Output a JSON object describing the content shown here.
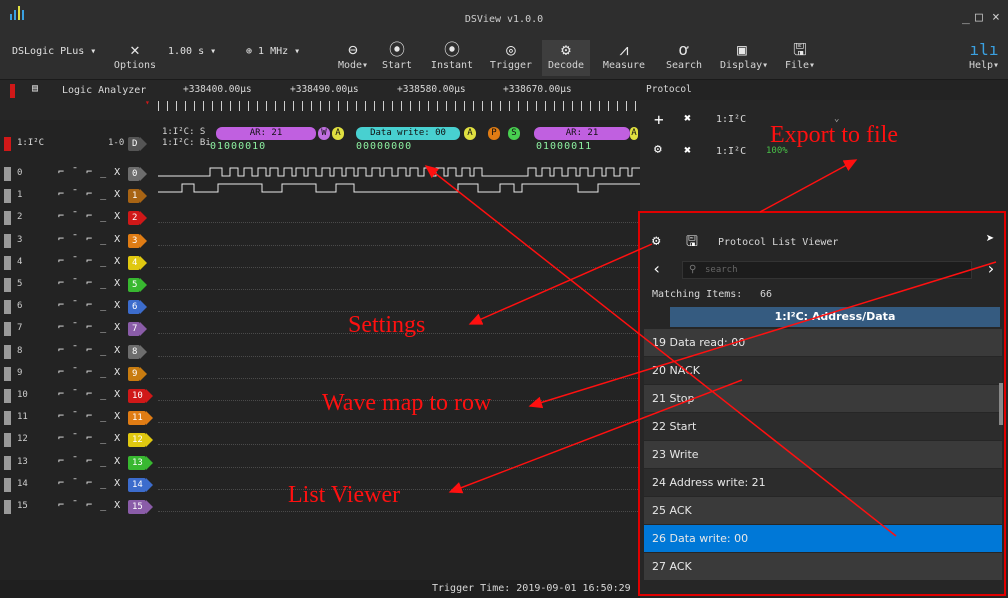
{
  "window": {
    "title": "DSView v1.0.0",
    "controls": [
      "_",
      "□",
      "×"
    ]
  },
  "toolbar": {
    "device": "DSLogic PLus",
    "options": "Options",
    "duration": "1.00 s",
    "rate": "1 MHz",
    "mode": "Mode",
    "start": "Start",
    "instant": "Instant",
    "trigger": "Trigger",
    "decode": "Decode",
    "measure": "Measure",
    "search": "Search",
    "display": "Display",
    "file": "File",
    "help": "Help"
  },
  "header": {
    "analyzer": "Logic Analyzer",
    "protocol": "Protocol",
    "time_labels": [
      "+338400.00μs",
      "+338490.00μs",
      "+338580.00μs",
      "+338670.00μs"
    ]
  },
  "decoder_row": {
    "name": "1:I²C",
    "range": "1-0",
    "tag": "D",
    "line1": "1:I²C: S",
    "line2": "1:I²C: Bi",
    "ar1": "AR: 21",
    "w": "W",
    "a1": "A",
    "dw": "Data write: 00",
    "a2": "A",
    "p": "P",
    "s": "S",
    "ar2": "AR: 21",
    "a3": "A",
    "bits1": "01000010",
    "bits2": "00000000",
    "bits3": "01000011"
  },
  "channels": [
    {
      "num": "0",
      "tag": "0",
      "color": "#6d6d6d"
    },
    {
      "num": "1",
      "tag": "1",
      "color": "#a86414"
    },
    {
      "num": "2",
      "tag": "2",
      "color": "#d01818"
    },
    {
      "num": "3",
      "tag": "3",
      "color": "#e07c14"
    },
    {
      "num": "4",
      "tag": "4",
      "color": "#e0c810"
    },
    {
      "num": "5",
      "tag": "5",
      "color": "#38b830"
    },
    {
      "num": "6",
      "tag": "6",
      "color": "#3c6ccc"
    },
    {
      "num": "7",
      "tag": "7",
      "color": "#8a5ca8"
    },
    {
      "num": "8",
      "tag": "8",
      "color": "#6d6d6d"
    },
    {
      "num": "9",
      "tag": "9",
      "color": "#c87c10"
    },
    {
      "num": "10",
      "tag": "10",
      "color": "#d01818"
    },
    {
      "num": "11",
      "tag": "11",
      "color": "#e07c14"
    },
    {
      "num": "12",
      "tag": "12",
      "color": "#e0c810"
    },
    {
      "num": "13",
      "tag": "13",
      "color": "#38b830"
    },
    {
      "num": "14",
      "tag": "14",
      "color": "#3c6ccc"
    },
    {
      "num": "15",
      "tag": "15",
      "color": "#8a5ca8"
    }
  ],
  "trigger_glyph": "⌐ ¯ ⌐ _ X",
  "status": {
    "trigger_time": "Trigger Time: 2019-09-01 16:50:29"
  },
  "protocol_panel": {
    "decoder1": "1:I²C",
    "decoder2": "1:I²C",
    "pct": "100%"
  },
  "list_viewer": {
    "title": "Protocol List Viewer",
    "search_placeholder": "search",
    "matching_label": "Matching Items:",
    "matching_count": "66",
    "column": "1:I²C: Address/Data",
    "rows": [
      {
        "idx": "19",
        "text": "Data read: 00"
      },
      {
        "idx": "20",
        "text": "NACK"
      },
      {
        "idx": "21",
        "text": "Stop"
      },
      {
        "idx": "22",
        "text": "Start"
      },
      {
        "idx": "23",
        "text": "Write"
      },
      {
        "idx": "24",
        "text": "Address write: 21"
      },
      {
        "idx": "25",
        "text": "ACK"
      },
      {
        "idx": "26",
        "text": "Data write: 00"
      },
      {
        "idx": "27",
        "text": "ACK"
      }
    ]
  },
  "annotations": {
    "export": "Export to file",
    "settings": "Settings",
    "wavemap": "Wave map to row",
    "listviewer": "List Viewer"
  },
  "colors": {
    "accent": "#0078d7",
    "annotation": "#ff1010",
    "decode_pill": "#b050d8",
    "data_pill": "#48d0d0"
  }
}
